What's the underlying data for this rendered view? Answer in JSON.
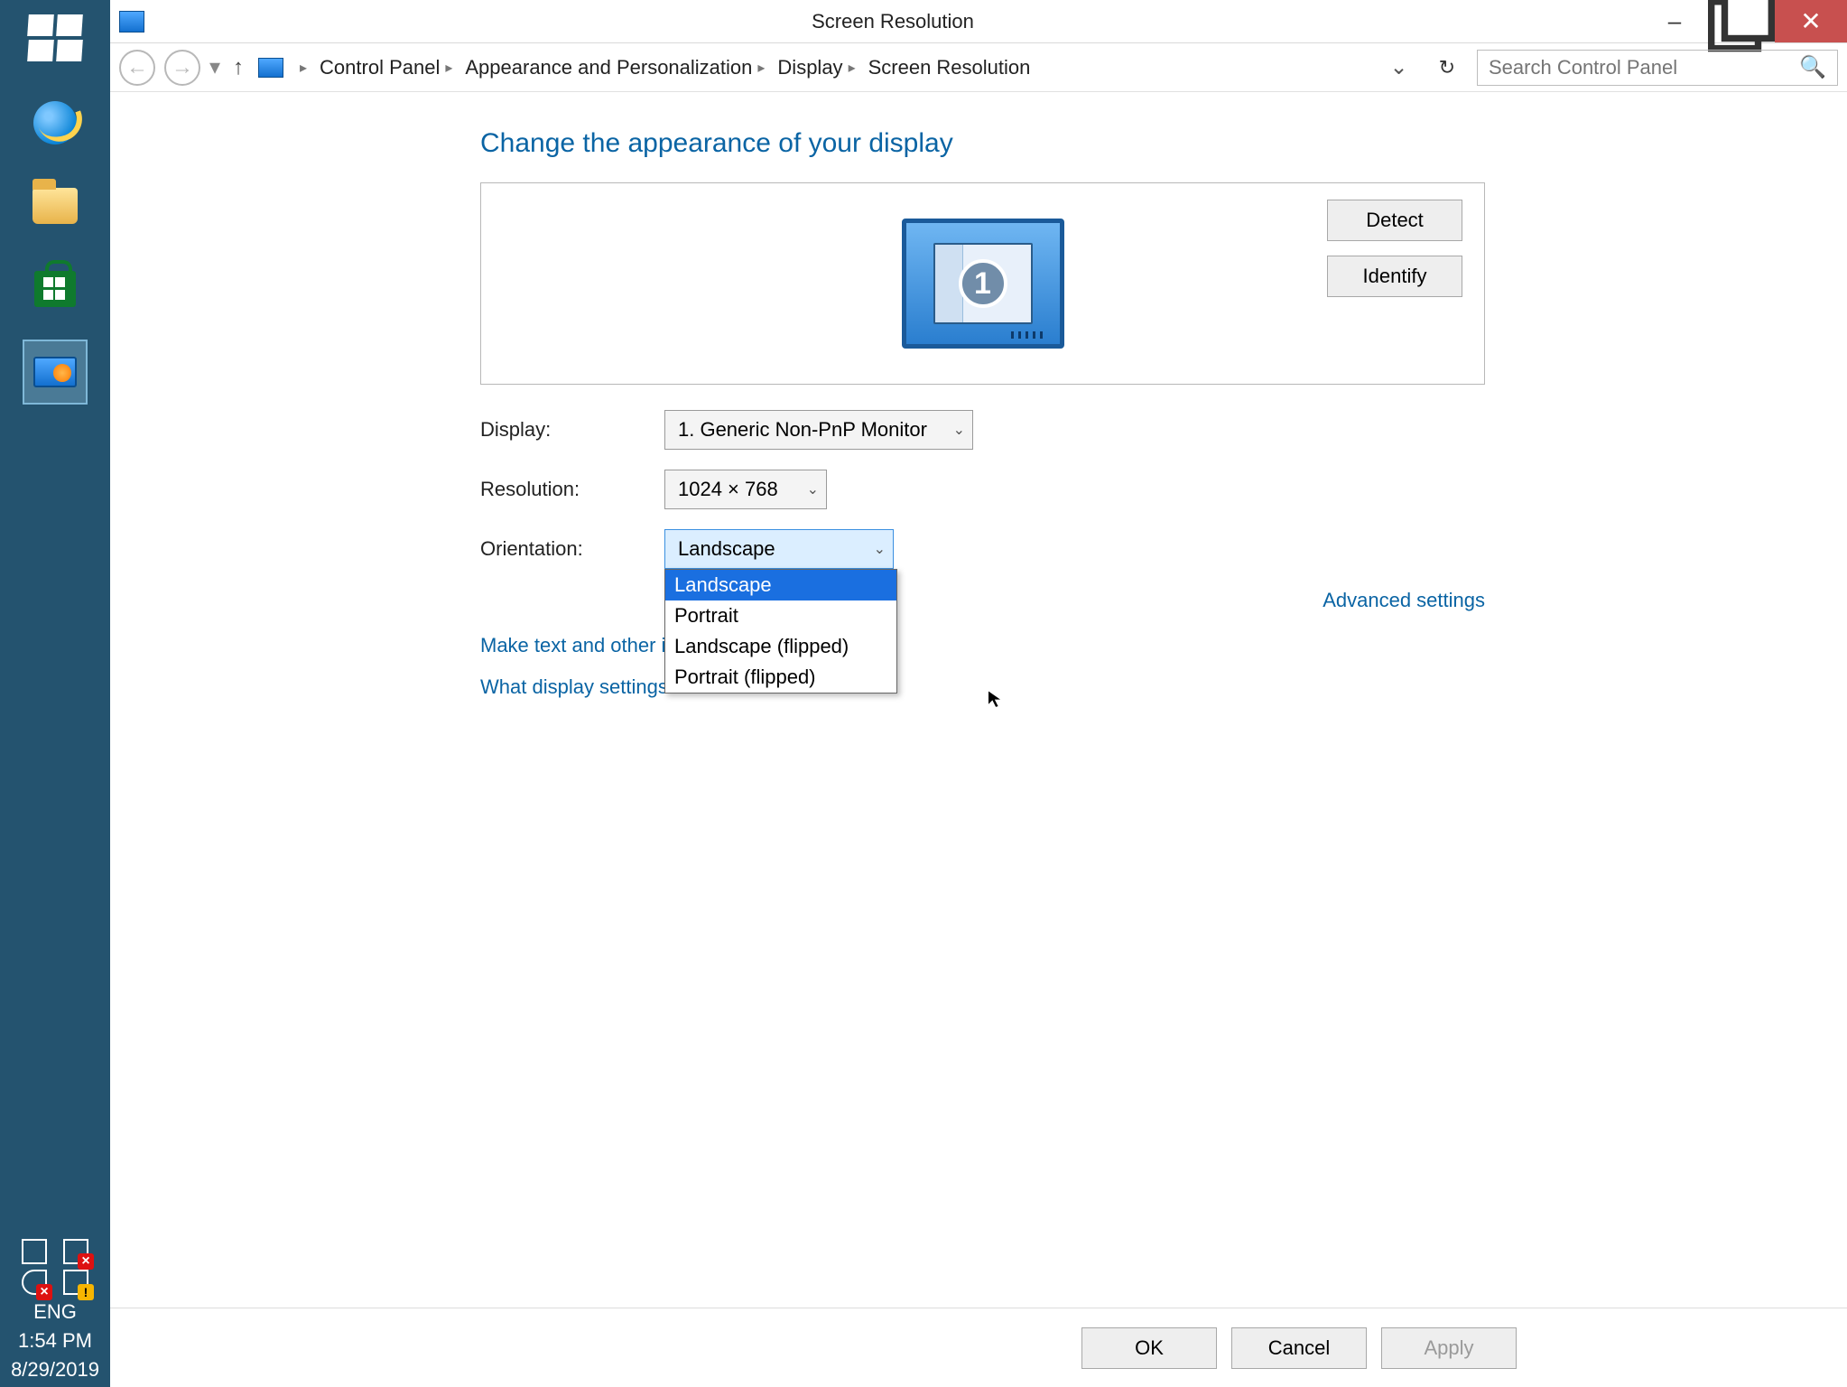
{
  "taskbar": {
    "items": [
      "start",
      "internet-explorer",
      "file-explorer",
      "store",
      "control-panel"
    ],
    "active_index": 4,
    "tray": {
      "lang": "ENG",
      "time": "1:54 PM",
      "date": "8/29/2019"
    }
  },
  "window": {
    "title": "Screen Resolution",
    "controls": {
      "min": "–",
      "max": "▢",
      "close": "✕"
    }
  },
  "breadcrumbs": [
    "Control Panel",
    "Appearance and Personalization",
    "Display",
    "Screen Resolution"
  ],
  "search": {
    "placeholder": "Search Control Panel"
  },
  "page": {
    "heading": "Change the appearance of your display",
    "buttons": {
      "detect": "Detect",
      "identify": "Identify"
    },
    "monitor_number": "1",
    "labels": {
      "display": "Display:",
      "resolution": "Resolution:",
      "orientation": "Orientation:"
    },
    "values": {
      "display": "1. Generic Non-PnP Monitor",
      "resolution": "1024 × 768",
      "orientation": "Landscape"
    },
    "orientation_options": [
      "Landscape",
      "Portrait",
      "Landscape (flipped)",
      "Portrait (flipped)"
    ],
    "orientation_selected_index": 0,
    "links": {
      "advanced": "Advanced settings",
      "text_size": "Make text and other items larger or smaller",
      "help": "What display settings should I choose?"
    }
  },
  "footer": {
    "ok": "OK",
    "cancel": "Cancel",
    "apply": "Apply"
  }
}
